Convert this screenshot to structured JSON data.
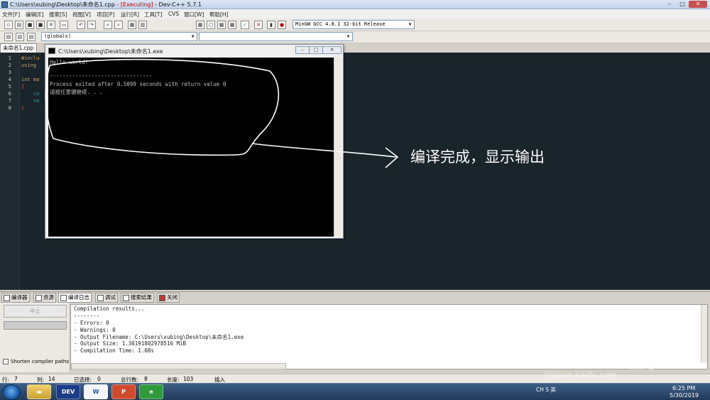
{
  "window": {
    "title_path": "C:\\Users\\xubing\\Desktop\\未命名1.cpp",
    "title_exec": " - [Executing]",
    "title_app": " - Dev-C++ 5.7.1",
    "min": "–",
    "max": "□",
    "close": "✕"
  },
  "menu": [
    "文件[F]",
    "编辑[E]",
    "搜索[S]",
    "视图[V]",
    "项目[P]",
    "运行[R]",
    "工具[T]",
    "CVS",
    "窗口[W]",
    "帮助[H]"
  ],
  "toolbar": {
    "compiler_select": "MinGW GCC 4.8.1 32-bit Release",
    "scope_select": "(globals)"
  },
  "editor": {
    "file_tab": "未命名1.cpp",
    "line_numbers": [
      "1",
      "2",
      "3",
      "4",
      "5",
      "6",
      "7",
      "8"
    ],
    "code_lines": [
      "#inclu",
      "using ",
      "",
      "int ma",
      "{",
      "    co",
      "    re",
      "}"
    ]
  },
  "console": {
    "title": "C:\\Users\\xubing\\Desktop\\未命名1.exe",
    "lines": [
      "Hello world!",
      "",
      "--------------------------------",
      "",
      "Process exited after 0.5099 seconds with return value 0",
      "请按任意键继续. . ."
    ]
  },
  "annotation": "编译完成，显示输出",
  "bottom_tabs": [
    "编译器",
    "资源",
    "编译日志",
    "调试",
    "搜索结果",
    "关闭"
  ],
  "compile_panel": {
    "abort_label": "中止",
    "shorten_label": "Shorten compiler paths",
    "log_lines": [
      "Compilation results...",
      "--------",
      "- Errors: 0",
      "- Warnings: 0",
      "- Output Filename: C:\\Users\\xubing\\Desktop\\未命名1.exe",
      "- Output Size: 1.30191802978516 MiB",
      "- Compilation Time: 1.08s"
    ]
  },
  "status": {
    "row_label": "行:",
    "row": "7",
    "col_label": "列:",
    "col": "14",
    "sel_label": "已选择:",
    "sel": "0",
    "lines_label": "总行数:",
    "lines": "8",
    "len_label": "长度:",
    "len": "103",
    "mode": "插入"
  },
  "taskbar": {
    "tray_text": "CH  S 英",
    "time": "6:25 PM",
    "date": "5/30/2019"
  },
  "watermark": {
    "logo": "Baidu经验",
    "url": "jingyan.baidu.com"
  }
}
